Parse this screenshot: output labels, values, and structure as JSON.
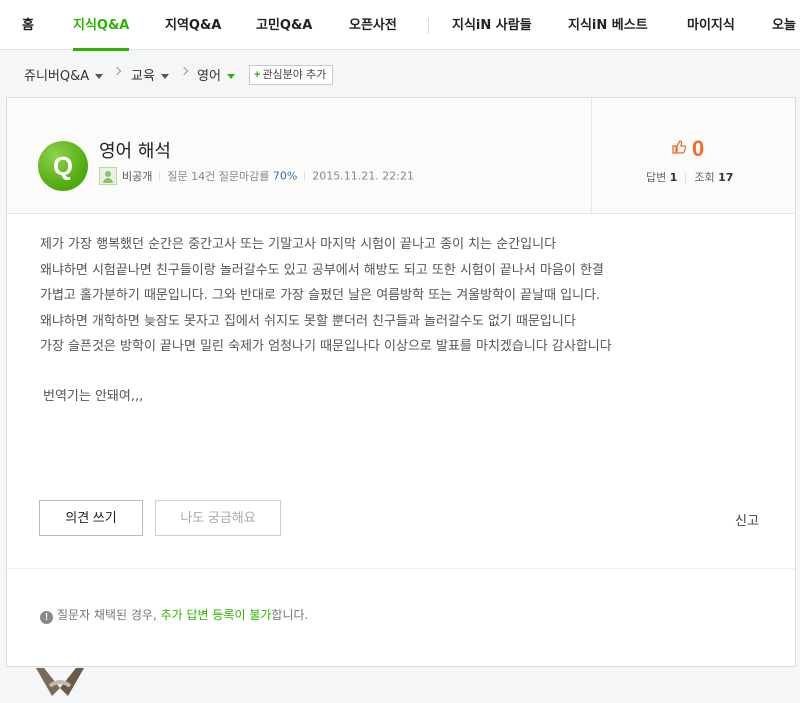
{
  "nav": {
    "items": [
      {
        "label": "홈",
        "active": false
      },
      {
        "label": "지식Q&A",
        "active": true
      },
      {
        "label": "지역Q&A",
        "active": false
      },
      {
        "label": "고민Q&A",
        "active": false
      },
      {
        "label": "오픈사전",
        "active": false
      },
      {
        "label": "지식iN 사람들",
        "active": false
      },
      {
        "label": "지식iN 베스트",
        "active": false
      },
      {
        "label": "마이지식",
        "active": false
      },
      {
        "label": "오늘",
        "active": false
      }
    ]
  },
  "breadcrumb": {
    "items": [
      "쥬니버Q&A",
      "교육",
      "영어"
    ],
    "interest_button": "관심분야 추가"
  },
  "question": {
    "badge": "Q",
    "title": "영어 해석",
    "author": "비공개",
    "stats_text": "질문 14건 질문마감률",
    "close_rate": "70%",
    "date": "2015.11.21. 22:21",
    "likes": "0",
    "answers_label": "답변",
    "answers": "1",
    "views_label": "조회",
    "views": "17",
    "body": [
      "제가 가장 행복했던 순간은 중간고사 또는 기말고사 마지막 시험이 끝나고 종이 치는 순간입니다",
      "왜냐하면 시험끝나면 친구들이랑 놀러갈수도 있고 공부에서 해방도 되고 또한 시험이 끝나서 마음이 한결",
      "가볍고 홀가분하기 때문입니다. 그와 반대로 가장 슬펐던 날은 여름방학 또는 겨울방학이 끝날때 입니다.",
      "왜냐하면 개학하면 늦잠도 못자고 집에서 쉬지도 못할 뿐더러 친구들과 놀러갈수도 없기 때문입니다",
      "가장 슬픈것은 방학이 끝나면 밀린 숙제가 엄청나기 때문입나다 이상으로 발표를 마치겠습니다 감사합니다"
    ],
    "note": "번역기는 안돼여,,,"
  },
  "actions": {
    "opinion": "의견 쓰기",
    "curious": "나도 궁금해요",
    "report": "신고"
  },
  "notice": {
    "icon": "!",
    "prefix": "질문자 채택된 경우, ",
    "highlight": "추가 답변 등록이 불가",
    "suffix": "합니다."
  },
  "colors": {
    "accent": "#2db400",
    "like": "#f16b2a"
  }
}
